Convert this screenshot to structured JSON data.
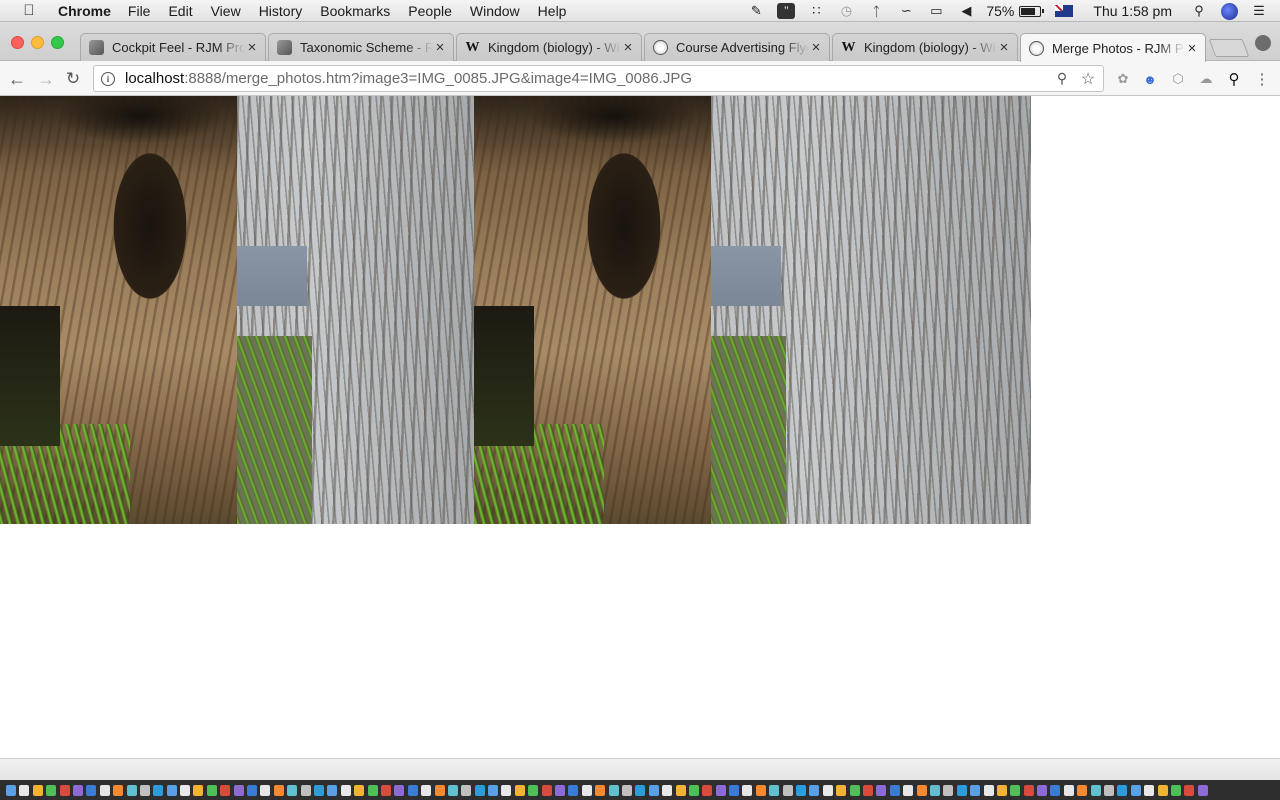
{
  "menubar": {
    "app_name": "Chrome",
    "items": [
      "File",
      "Edit",
      "View",
      "History",
      "Bookmarks",
      "People",
      "Window",
      "Help"
    ],
    "battery_percent": "75%",
    "battery_level": 0.75,
    "clock": "Thu 1:58 pm",
    "status_icons": [
      "script-icon",
      "quote-icon",
      "grid-icon",
      "time-machine-icon",
      "bluetooth-icon",
      "wifi-icon",
      "airplay-icon",
      "volume-icon"
    ]
  },
  "tabs": [
    {
      "title": "Cockpit Feel - RJM Programming",
      "favicon": "rjm",
      "active": false
    },
    {
      "title": "Taxonomic Scheme - RJM Programming",
      "favicon": "rjm",
      "active": false
    },
    {
      "title": "Kingdom (biology) - Wikipedia",
      "favicon": "wiki",
      "active": false
    },
    {
      "title": "Course Advertising Flyer",
      "favicon": "globe",
      "active": false
    },
    {
      "title": "Kingdom (biology) - Wikipedia",
      "favicon": "wiki",
      "active": false
    },
    {
      "title": "Merge Photos - RJM Programming",
      "favicon": "globe",
      "active": true
    }
  ],
  "omnibox": {
    "host": "localhost",
    "path": ":8888/merge_photos.htm?image3=IMG_0085.JPG&image4=IMG_0086.JPG"
  },
  "photos": [
    {
      "name": "photo-trunk-1",
      "kind": "trunk"
    },
    {
      "name": "photo-roots-1",
      "kind": "roots"
    },
    {
      "name": "photo-trunk-2",
      "kind": "trunk"
    },
    {
      "name": "photo-roots-2",
      "kind": "roots wide"
    }
  ],
  "colors": {
    "accent_active_tab": "#f6f6f6",
    "dock_background": "#2e2e2e"
  }
}
